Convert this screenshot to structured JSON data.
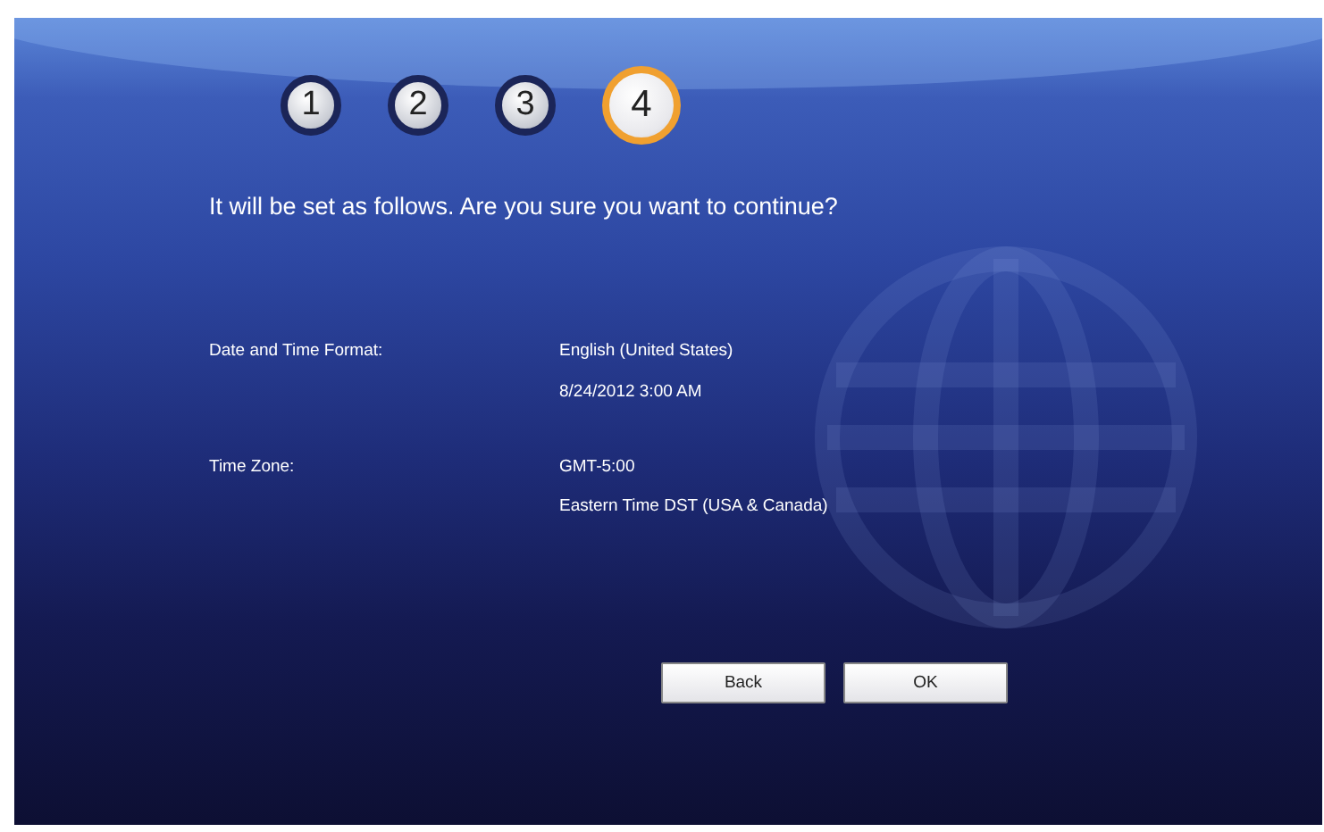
{
  "steps": [
    {
      "label": "1",
      "selected": false
    },
    {
      "label": "2",
      "selected": false
    },
    {
      "label": "3",
      "selected": false
    },
    {
      "label": "4",
      "selected": true
    }
  ],
  "prompt": "It will be set as follows. Are you sure you want to continue?",
  "settings": [
    {
      "label": "Date and Time Format:",
      "values": [
        "English (United States)",
        "8/24/2012 3:00 AM"
      ]
    },
    {
      "label": "Time Zone:",
      "values": [
        "GMT-5:00",
        "Eastern Time DST (USA & Canada)"
      ]
    }
  ],
  "buttons": [
    "Back",
    "OK"
  ]
}
